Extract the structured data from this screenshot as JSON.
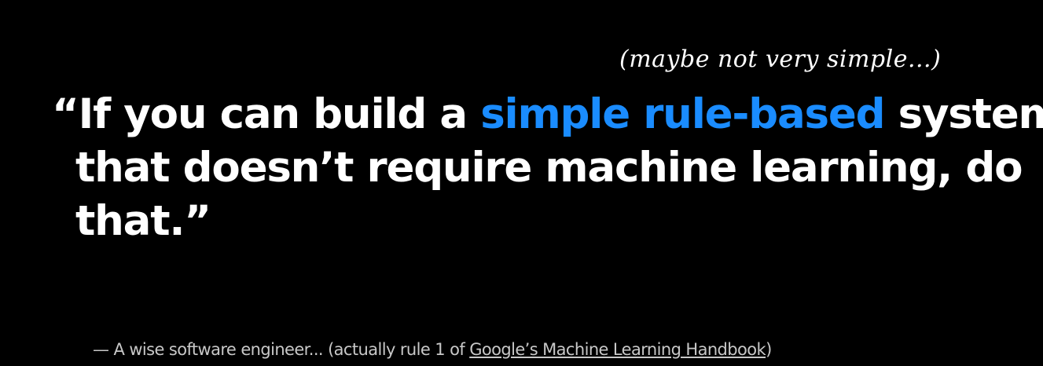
{
  "slide": {
    "aside_note": "(maybe not very simple...)",
    "quote": {
      "line1_before": "“If you can build a ",
      "line1_highlight": "simple rule-based",
      "line1_after": " system",
      "line2": "that doesn’t require machine learning, do",
      "line3": "that.”"
    },
    "attribution": {
      "prefix": "— A wise software engineer... (actually rule 1 of ",
      "link_text": "Google’s Machine Learning Handbook",
      "suffix": ")"
    },
    "colors": {
      "background": "#000000",
      "text": "#ffffff",
      "highlight": "#1a8cff",
      "attribution": "#c8c8c8"
    }
  }
}
